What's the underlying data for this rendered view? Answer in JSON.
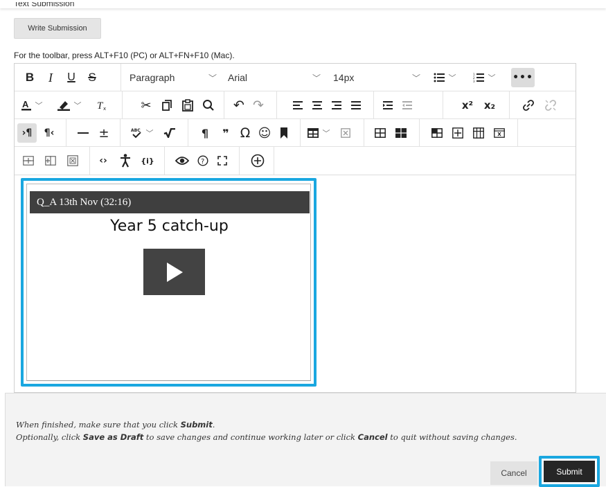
{
  "header": {
    "section_label": "Text Submission",
    "write_submission_label": "Write Submission",
    "toolbar_hint": "For the toolbar, press ALT+F10 (PC) or ALT+FN+F10 (Mac)."
  },
  "toolbar": {
    "paragraph_value": "Paragraph",
    "font_value": "Arial",
    "size_value": "14px",
    "more_label": "•••",
    "bold": "B",
    "italic": "I",
    "underline": "U",
    "strike": "S",
    "superscript": "x²",
    "subscript": "x₂",
    "paragraph_mark": "¶",
    "quote_mark": "❞",
    "omega": "Ω",
    "emoji": "☺"
  },
  "editor": {
    "video_bar_text": "Q_A 13th Nov (32:16)",
    "video_title": "Year 5 catch-up"
  },
  "footer": {
    "instruction_line1_pre": "When finished, make sure that you click ",
    "instruction_line1_bold": "Submit",
    "instruction_line1_post": ".",
    "instruction_line2_pre": "Optionally, click ",
    "instruction_line2_bold1": "Save as Draft",
    "instruction_line2_mid": " to save changes and continue working later or click ",
    "instruction_line2_bold2": "Cancel",
    "instruction_line2_post": " to quit without saving changes.",
    "cancel_label": "Cancel",
    "submit_label": "Submit"
  },
  "colors": {
    "highlight": "#1aa7e0",
    "submit_bg": "#262626",
    "video_bar_bg": "#3f3f3f"
  }
}
